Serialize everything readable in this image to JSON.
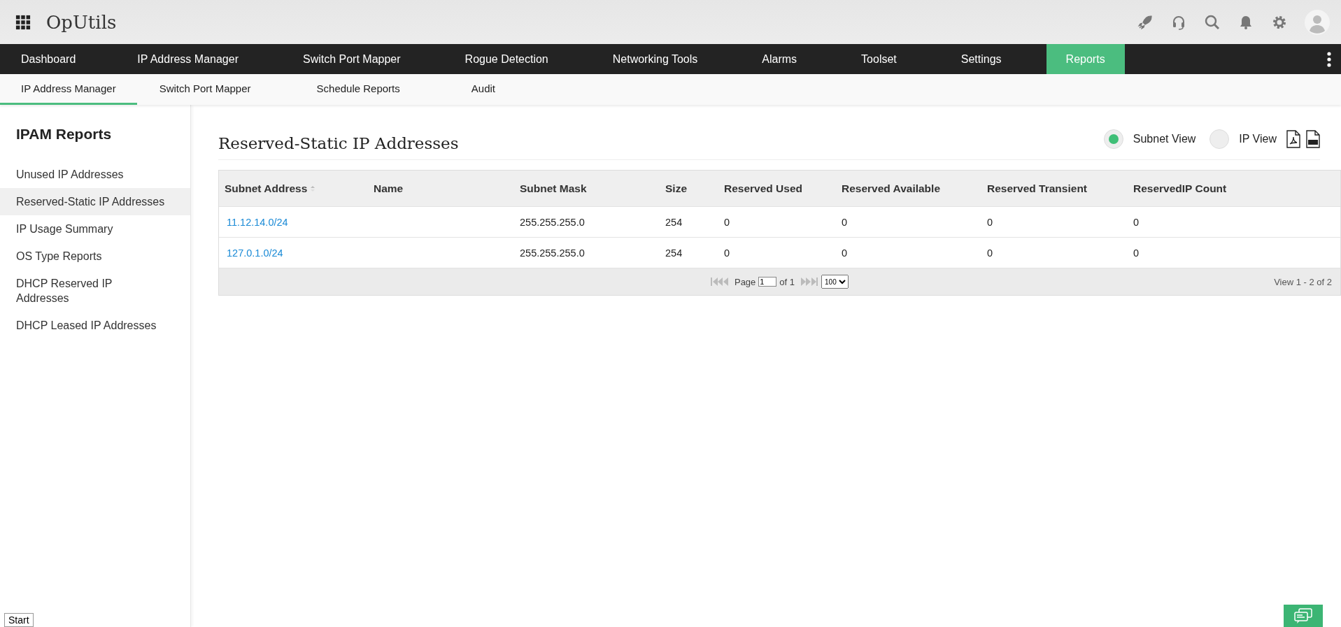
{
  "app": {
    "title": "OpUtils"
  },
  "nav": [
    {
      "label": "Dashboard",
      "selected": false
    },
    {
      "label": "IP Address Manager",
      "selected": false
    },
    {
      "label": "Switch Port Mapper",
      "selected": false
    },
    {
      "label": "Rogue Detection",
      "selected": false
    },
    {
      "label": "Networking Tools",
      "selected": false
    },
    {
      "label": "Alarms",
      "selected": false
    },
    {
      "label": "Toolset",
      "selected": false
    },
    {
      "label": "Settings",
      "selected": false
    },
    {
      "label": "Reports",
      "selected": true
    }
  ],
  "subnav": [
    {
      "label": "IP Address Manager",
      "selected": true
    },
    {
      "label": "Switch Port Mapper",
      "selected": false
    },
    {
      "label": "Schedule Reports",
      "selected": false
    },
    {
      "label": "Audit",
      "selected": false
    }
  ],
  "sidebar": {
    "title": "IPAM Reports",
    "items": [
      {
        "label": "Unused IP Addresses",
        "selected": false
      },
      {
        "label": "Reserved-Static IP Addresses",
        "selected": true
      },
      {
        "label": "IP Usage Summary",
        "selected": false
      },
      {
        "label": "OS Type Reports",
        "selected": false
      },
      {
        "label": "DHCP Reserved IP Addresses",
        "selected": false
      },
      {
        "label": "DHCP Leased IP Addresses",
        "selected": false
      }
    ]
  },
  "report": {
    "title": "Reserved-Static IP Addresses",
    "views": [
      {
        "label": "Subnet View",
        "selected": true
      },
      {
        "label": "IP View",
        "selected": false
      }
    ],
    "table": {
      "columns": [
        {
          "label": "Subnet Address",
          "sorted": true
        },
        {
          "label": "Name",
          "sorted": false
        },
        {
          "label": "Subnet Mask",
          "sorted": false
        },
        {
          "label": "Size",
          "sorted": false
        },
        {
          "label": "Reserved Used",
          "sorted": false
        },
        {
          "label": "Reserved Available",
          "sorted": false
        },
        {
          "label": "Reserved Transient",
          "sorted": false
        },
        {
          "label": "ReservedIP Count",
          "sorted": false
        }
      ],
      "rows": [
        [
          "11.12.14.0/24",
          "",
          "255.255.255.0",
          "254",
          "0",
          "0",
          "0",
          "0"
        ],
        [
          "127.0.1.0/24",
          "",
          "255.255.255.0",
          "254",
          "0",
          "0",
          "0",
          "0"
        ]
      ]
    },
    "pager": {
      "page_label": "Page",
      "page": "1",
      "of": "of 1",
      "page_size": "100",
      "summary": "View 1 - 2 of 2"
    }
  },
  "start_button": "Start"
}
